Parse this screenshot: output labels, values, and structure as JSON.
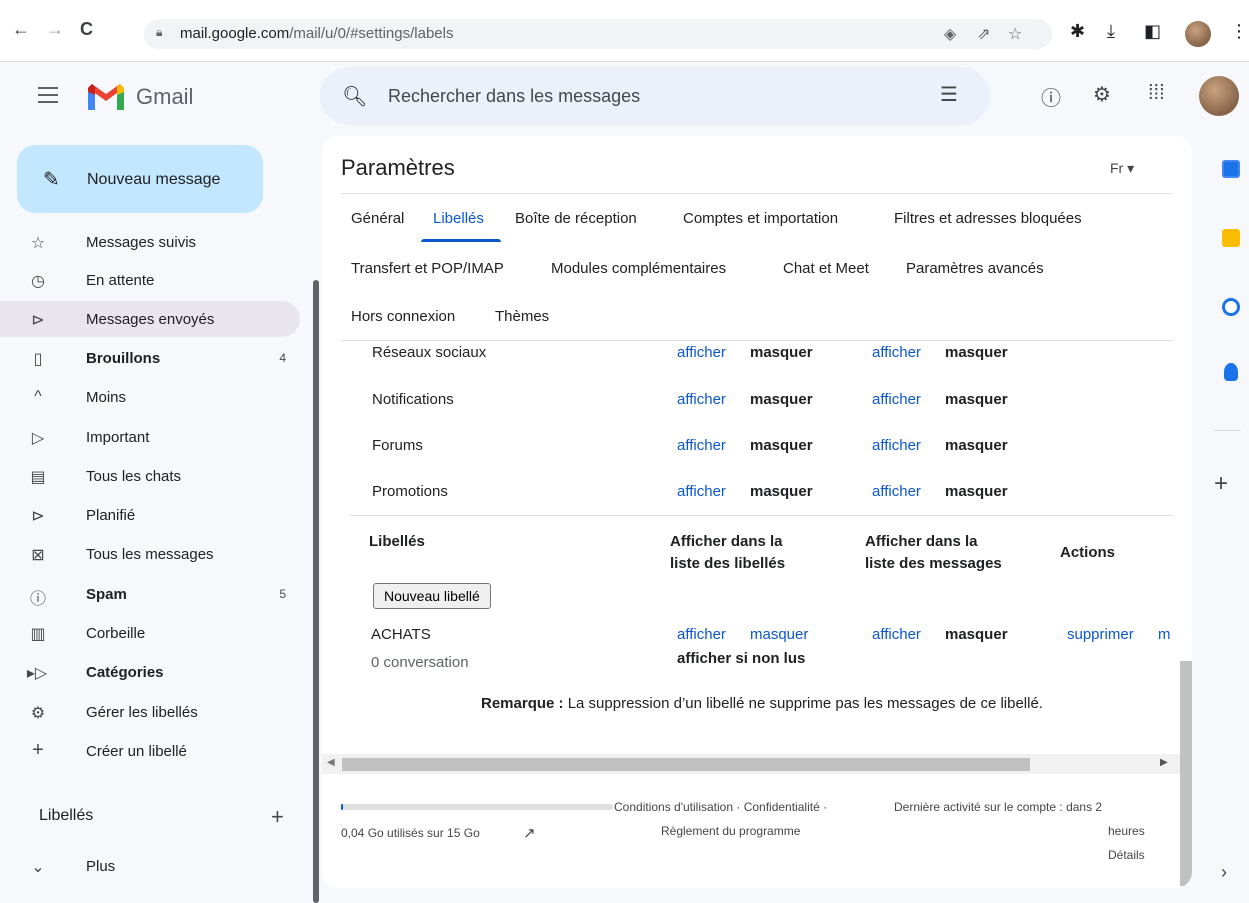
{
  "browser": {
    "url_host": "mail.google.com",
    "url_path": "/mail/u/0/#settings/labels",
    "back": "←",
    "forward": "→",
    "reload": "C"
  },
  "header": {
    "app_name": "Gmail",
    "search_placeholder": "Rechercher dans les messages"
  },
  "compose": {
    "label": "Nouveau message"
  },
  "sidebar": {
    "items": [
      {
        "label": "Messages suivis",
        "icon": "star-icon",
        "glyph": "☆"
      },
      {
        "label": "En attente",
        "icon": "clock-icon",
        "glyph": "◷"
      },
      {
        "label": "Messages envoyés",
        "icon": "send-icon",
        "glyph": "⊳"
      },
      {
        "label": "Brouillons",
        "icon": "draft-icon",
        "glyph": "▯",
        "count": "4"
      },
      {
        "label": "Moins",
        "icon": "chevron-up-icon",
        "glyph": "^"
      },
      {
        "label": "Important",
        "icon": "important-icon",
        "glyph": "▷"
      },
      {
        "label": "Tous les chats",
        "icon": "chat-icon",
        "glyph": "▤"
      },
      {
        "label": "Planifié",
        "icon": "scheduled-icon",
        "glyph": "⊳"
      },
      {
        "label": "Tous les messages",
        "icon": "all-mail-icon",
        "glyph": "⊠"
      },
      {
        "label": "Spam",
        "icon": "spam-icon",
        "glyph": "ⓘ",
        "count": "5"
      },
      {
        "label": "Corbeille",
        "icon": "trash-icon",
        "glyph": "▥"
      },
      {
        "label": "Catégories",
        "icon": "label-icon",
        "glyph": "▸▷"
      },
      {
        "label": "Gérer les libellés",
        "icon": "gear-icon",
        "glyph": "⚙"
      },
      {
        "label": "Créer un libellé",
        "icon": "plus-icon",
        "glyph": "+"
      }
    ],
    "labels_heading": "Libellés",
    "more": {
      "label": "Plus",
      "glyph": "⌄"
    }
  },
  "settings": {
    "title": "Paramètres",
    "lang": "Fr ▾",
    "tabs_row1": [
      "Général",
      "Libellés",
      "Boîte de réception",
      "Comptes et importation",
      "Filtres et adresses bloquées"
    ],
    "tabs_row2": [
      "Transfert et POP/IMAP",
      "Modules complémentaires",
      "Chat et Meet",
      "Paramètres avancés"
    ],
    "tabs_row3": [
      "Hors connexion",
      "Thèmes"
    ],
    "active_tab": "Libellés",
    "categories": [
      {
        "name": "Réseaux sociaux",
        "show1": "afficher",
        "hide1": "masquer",
        "show2": "afficher",
        "hide2": "masquer"
      },
      {
        "name": "Notifications",
        "show1": "afficher",
        "hide1": "masquer",
        "show2": "afficher",
        "hide2": "masquer"
      },
      {
        "name": "Forums",
        "show1": "afficher",
        "hide1": "masquer",
        "show2": "afficher",
        "hide2": "masquer"
      },
      {
        "name": "Promotions",
        "show1": "afficher",
        "hide1": "masquer",
        "show2": "afficher",
        "hide2": "masquer"
      }
    ],
    "labels_table": {
      "h_labels": "Libellés",
      "h_list_line1": "Afficher dans la",
      "h_list_line2": "liste des libellés",
      "h_msgs_line1": "Afficher dans la",
      "h_msgs_line2": "liste des messages",
      "h_actions": "Actions",
      "new_label_button": "Nouveau libellé",
      "row": {
        "name": "ACHATS",
        "count": "0 conversation",
        "show1": "afficher",
        "hide1": "masquer",
        "unread": "afficher si non lus",
        "show2": "afficher",
        "hide2": "masquer",
        "delete": "supprimer",
        "edit_cut": "m"
      }
    },
    "note_bold": "Remarque :",
    "note_text": " La suppression d’un libellé ne supprime pas les messages de ce libellé."
  },
  "footer": {
    "storage": "0,04 Go utilisés sur 15 Go",
    "storage_fraction": 0.003,
    "terms": "Conditions d'utilisation · Confidentialité ·",
    "program": "Règlement du programme",
    "activity_line1": "Dernière activité sur le compte : dans 2",
    "activity_line2": "heures",
    "details": "Détails"
  },
  "colors": {
    "accent": "#0b57d0",
    "compose": "#c2e7ff",
    "search": "#eaf1fb"
  }
}
